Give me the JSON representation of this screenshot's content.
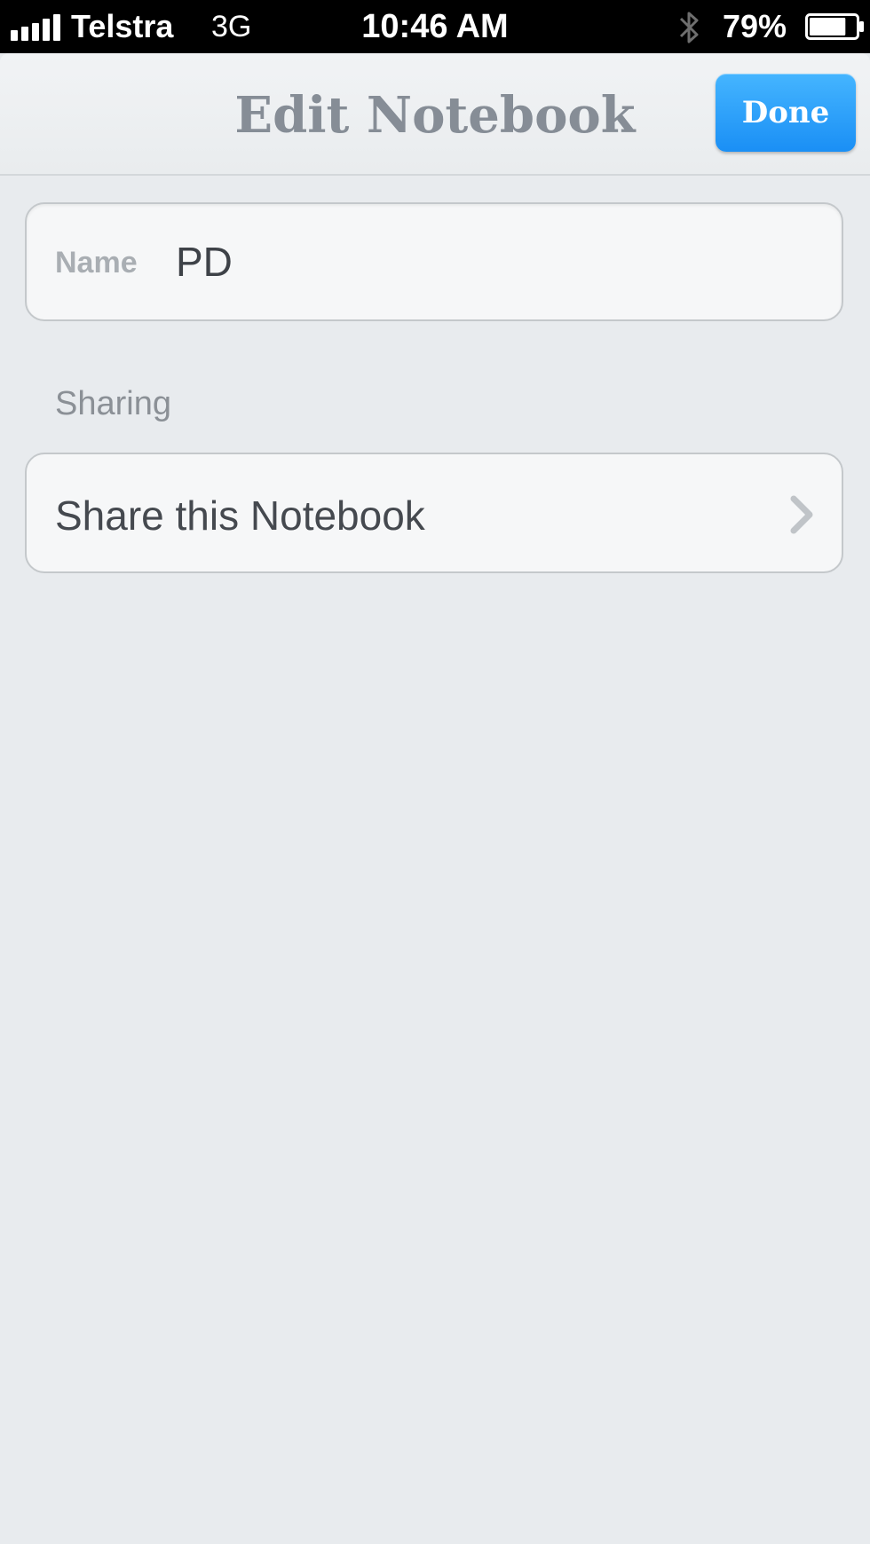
{
  "status_bar": {
    "carrier": "Telstra",
    "network": "3G",
    "time": "10:46 AM",
    "battery": "79%",
    "signal_icon": "signal-bars-icon",
    "bluetooth_icon": "bluetooth-icon",
    "battery_icon": "battery-icon",
    "battery_level": 0.79
  },
  "header": {
    "title": "Edit Notebook",
    "done_label": "Done",
    "done_color": "#1a8ff5"
  },
  "form": {
    "name_label": "Name",
    "name_value": "PD",
    "sharing_section": "Sharing",
    "share_label": "Share this Notebook",
    "share_icon": "chevron-right-icon"
  }
}
